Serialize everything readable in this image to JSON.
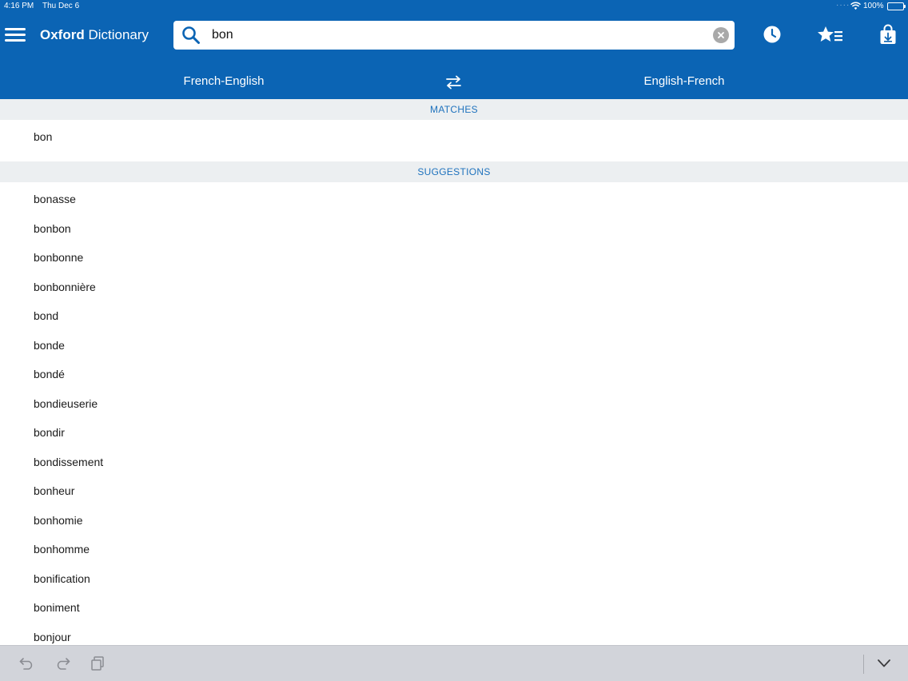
{
  "status_bar": {
    "time": "4:16 PM",
    "date": "Thu Dec 6",
    "battery": "100%"
  },
  "header": {
    "brand": "Oxford",
    "title_rest": " Dictionary",
    "background_color": "#0b64b4",
    "search": {
      "value": "bon",
      "placeholder": ""
    }
  },
  "language_bar": {
    "source": "French-English",
    "target": "English-French"
  },
  "results": {
    "matches_label": "MATCHES",
    "matches": [
      "bon"
    ],
    "suggestions_label": "SUGGESTIONS",
    "suggestions": [
      "bonasse",
      "bonbon",
      "bonbonne",
      "bonbonnière",
      "bond",
      "bonde",
      "bondé",
      "bondieuserie",
      "bondir",
      "bondissement",
      "bonheur",
      "bonhomie",
      "bonhomme",
      "bonification",
      "boniment",
      "bonjour"
    ]
  },
  "icons": {
    "menu": "hamburger-menu-icon",
    "search": "magnifier-icon",
    "clear": "clear-x-icon",
    "history": "clock-icon",
    "favorites": "star-list-icon",
    "store": "shopping-bag-download-icon",
    "swap": "swap-arrows-icon",
    "undo": "undo-icon",
    "redo": "redo-icon",
    "paste": "paste-icon",
    "dismiss_keyboard": "chevron-down-icon"
  }
}
